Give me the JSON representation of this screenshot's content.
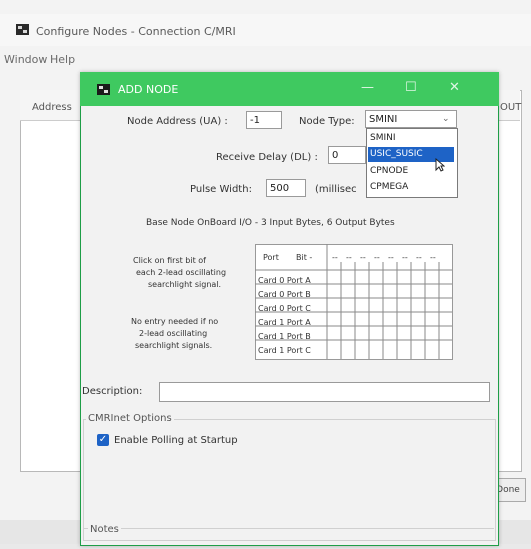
{
  "background_window": {
    "title": "Configure Nodes - Connection C/MRI",
    "menu": [
      "Window",
      "Help"
    ],
    "columns": [
      "Address",
      "OUT"
    ],
    "done_label": "Done"
  },
  "dialog": {
    "title": "ADD NODE",
    "node_address_label": "Node Address (UA) :",
    "node_address_value": "-1",
    "node_type_label": "Node Type:",
    "node_type_selected": "SMINI",
    "node_type_options": [
      "SMINI",
      "USIC_SUSIC",
      "CPNODE",
      "CPMEGA"
    ],
    "highlighted_option_index": 1,
    "receive_delay_label": "Receive Delay (DL) :",
    "receive_delay_value": "0",
    "pulse_width_label": "Pulse Width:",
    "pulse_width_value": "500",
    "pulse_width_unit": "(millisec",
    "onboard_info": "Base Node OnBoard I/O - 3 Input Bytes, 6 Output Bytes",
    "searchlight_help_1": [
      "Click on first bit of",
      "each 2-lead oscillating",
      "searchlight signal."
    ],
    "searchlight_help_2": [
      "No entry needed if no",
      "2-lead oscillating",
      "searchlight signals."
    ],
    "grid": {
      "header_port": "Port",
      "header_bit": "Bit -",
      "header_dashes": [
        "--",
        "--",
        "--",
        "--",
        "--",
        "--",
        "--",
        "--"
      ],
      "rows": [
        "Card 0 Port A",
        "Card 0 Port B",
        "Card 0 Port C",
        "Card 1 Port A",
        "Card 1 Port B",
        "Card 1 Port C"
      ]
    },
    "description_label": "Description:",
    "description_value": "",
    "cmrinet_group_label": "CMRInet Options",
    "enable_polling_label": "Enable Polling at Startup",
    "enable_polling_checked": true,
    "notes_label": "Notes"
  },
  "colors": {
    "accent": "#3fc960",
    "selection": "#1e63c6"
  },
  "icons": [
    "app-icon",
    "minimize-icon",
    "maximize-icon",
    "close-icon",
    "dropdown-chevron-icon",
    "mouse-cursor-icon",
    "checkmark-icon"
  ]
}
